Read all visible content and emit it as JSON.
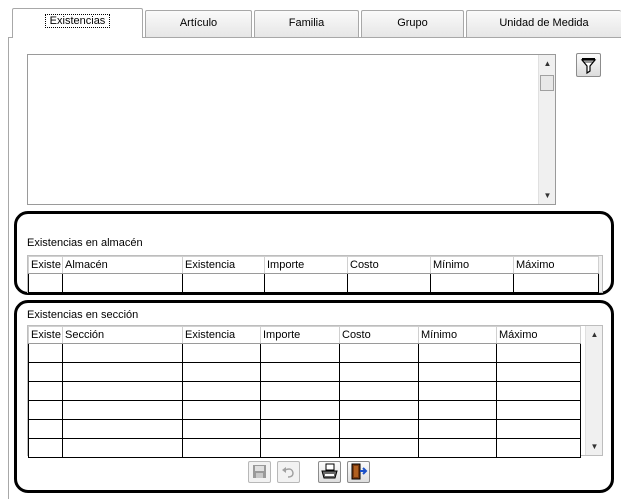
{
  "tabs": [
    {
      "label": "Existencias",
      "active": true
    },
    {
      "label": "Artículo",
      "active": false
    },
    {
      "label": "Familia",
      "active": false
    },
    {
      "label": "Grupo",
      "active": false
    },
    {
      "label": "Unidad de Medida",
      "active": false
    }
  ],
  "filter_button": {
    "icon": "filter-icon"
  },
  "almacen": {
    "title": "Existencias en almacén",
    "columns": [
      "Existe",
      "Almacén",
      "Existencia",
      "Importe",
      "Costo",
      "Mínimo",
      "Máximo"
    ]
  },
  "seccion": {
    "title": "Existencias en sección",
    "columns": [
      "Existe",
      "Sección",
      "Existencia",
      "Importe",
      "Costo",
      "Mínimo",
      "Máximo"
    ]
  },
  "toolbar": {
    "save": {
      "icon": "save-icon",
      "enabled": false
    },
    "undo": {
      "icon": "undo-icon",
      "enabled": false
    },
    "print": {
      "icon": "printer-icon",
      "enabled": true
    },
    "exit": {
      "icon": "exit-door-icon",
      "enabled": true
    }
  },
  "colors": {
    "highlight_border": "#000000",
    "pane_border": "#a8a8a8"
  }
}
